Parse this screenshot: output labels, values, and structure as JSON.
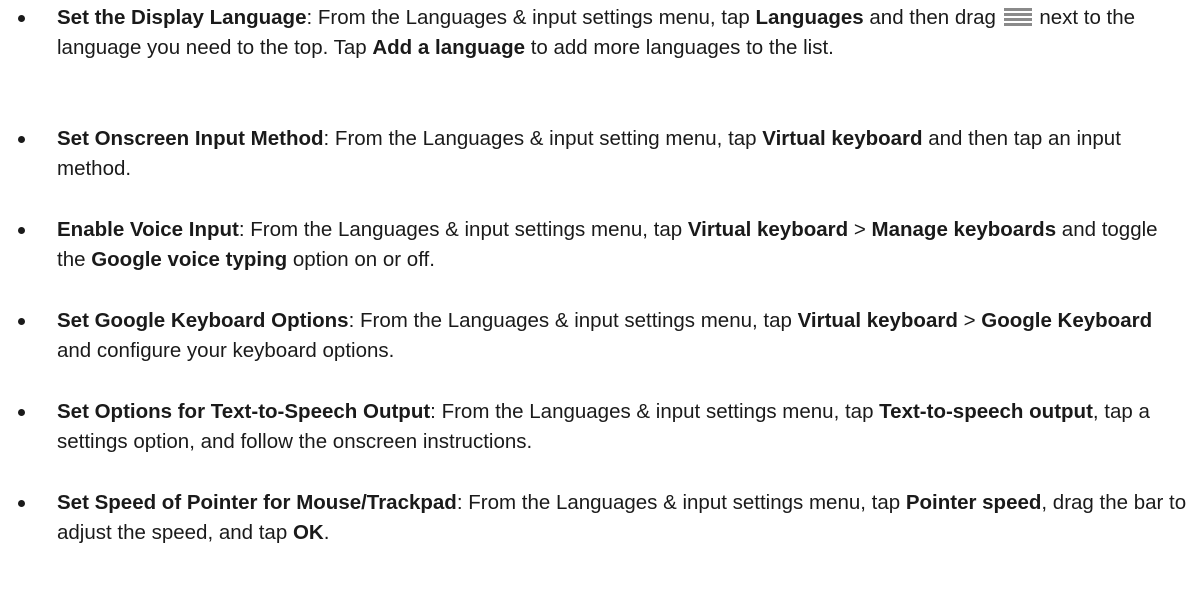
{
  "items": [
    {
      "title": "Set the Display Language",
      "seg1": ": From the Languages & input settings menu, tap ",
      "b1": "Languages",
      "seg2": " and then drag ",
      "icon": "drag-handle-icon",
      "seg3": " next to the language you need to the top. Tap ",
      "b2": "Add a language",
      "seg4": " to add more languages to the list."
    },
    {
      "title": "Set Onscreen Input Method",
      "seg1": ": From the Languages & input setting menu, tap ",
      "b1": "Virtual keyboard",
      "seg2": " and then tap an input method."
    },
    {
      "title": "Enable Voice Input",
      "seg1": ": From the Languages & input settings menu, tap ",
      "b1": "Virtual keyboard",
      "seg2": " > ",
      "b2": "Manage keyboards",
      "seg3": " and toggle the ",
      "b3": "Google voice typing",
      "seg4": " option on or off."
    },
    {
      "title": "Set Google Keyboard Options",
      "seg1": ": From the Languages & input settings menu, tap ",
      "b1": "Virtual keyboard",
      "seg2": " > ",
      "b2": "Google Keyboard",
      "seg3": " and configure your keyboard options."
    },
    {
      "title": "Set Options for Text-to-Speech Output",
      "seg1": ": From the Languages & input settings menu, tap ",
      "b1": "Text-to-speech output",
      "seg2": ", tap a settings option, and follow the onscreen instructions."
    },
    {
      "title": "Set Speed of Pointer for Mouse/Trackpad",
      "seg1": ": From the Languages & input settings menu, tap ",
      "b1": "Pointer speed",
      "seg2": ", drag the bar to adjust the speed, and tap ",
      "b2": "OK",
      "seg3": "."
    }
  ]
}
